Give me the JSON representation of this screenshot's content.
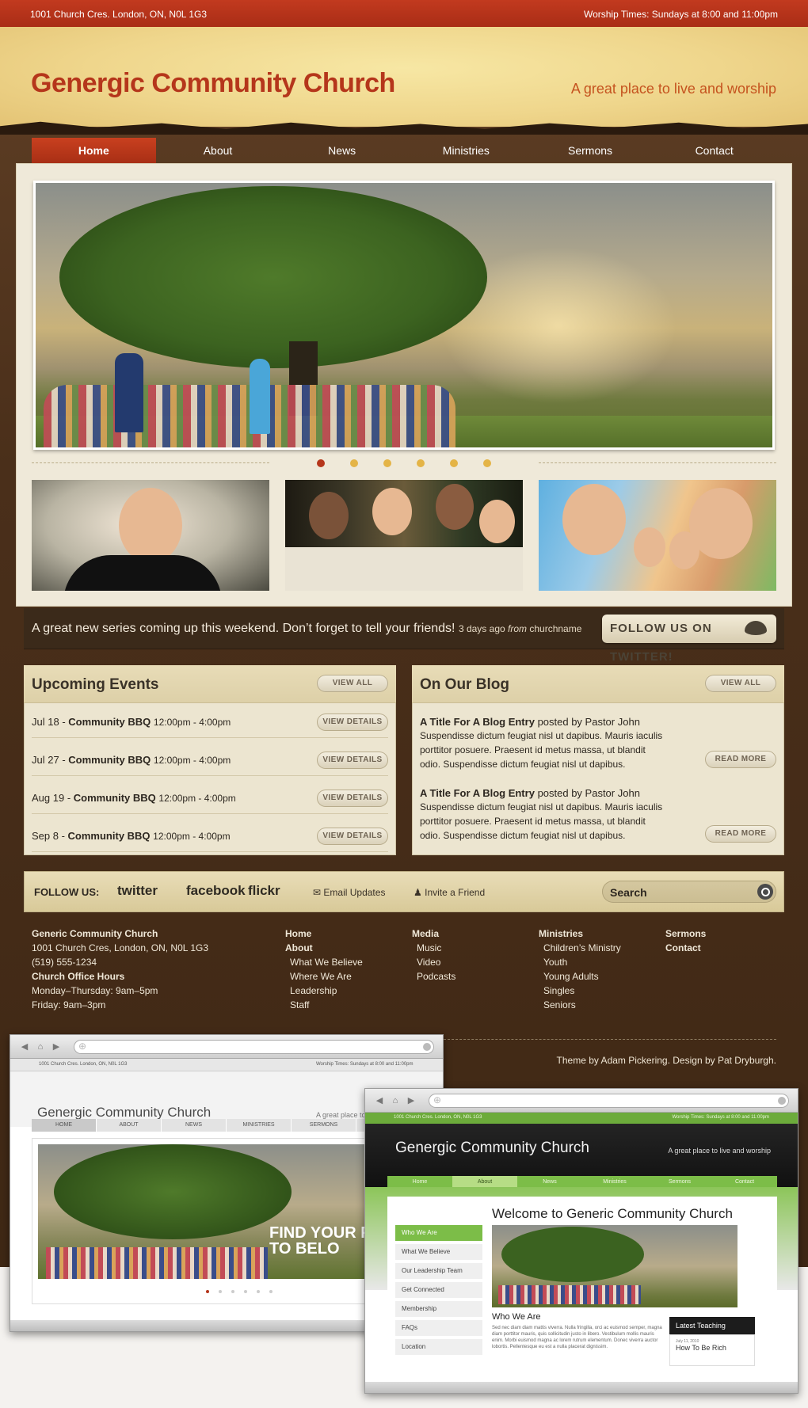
{
  "topbar": {
    "address": "1001 Church Cres. London, ON, N0L 1G3",
    "worship_times": "Worship Times: Sundays at 8:00 and 11:00pm"
  },
  "header": {
    "title": "Genergic Community Church",
    "tagline": "A great place to live and worship"
  },
  "nav": [
    "Home",
    "About",
    "News",
    "Ministries",
    "Sermons",
    "Contact"
  ],
  "slider": {
    "slide_count": 6,
    "active_slide": 1
  },
  "twitter": {
    "message": "A great new series coming up this weekend. Don’t forget to tell your friends!",
    "meta_time": "3 days ago",
    "meta_from": "from",
    "meta_source": "churchname",
    "follow_label": "FOLLOW US ON TWITTER!"
  },
  "events": {
    "title": "Upcoming Events",
    "view_all": "VIEW ALL",
    "details_label": "VIEW DETAILS",
    "items": [
      {
        "date": "Jul 18",
        "name": "Community BBQ",
        "time": "12:00pm - 4:00pm"
      },
      {
        "date": "Jul 27",
        "name": "Community BBQ",
        "time": "12:00pm - 4:00pm"
      },
      {
        "date": "Aug 19",
        "name": "Community BBQ",
        "time": "12:00pm - 4:00pm"
      },
      {
        "date": "Sep 8",
        "name": "Community BBQ",
        "time": "12:00pm - 4:00pm"
      }
    ]
  },
  "blog": {
    "title": "On Our Blog",
    "view_all": "VIEW ALL",
    "read_more": "READ MORE",
    "entries": [
      {
        "title": "A Title For A Blog Entry",
        "byline": "posted by Pastor John",
        "body": "Suspendisse dictum feugiat nisl ut dapibus. Mauris iaculis porttitor posuere. Praesent id metus massa, ut blandit odio. Suspendisse dictum feugiat nisl ut dapibus."
      },
      {
        "title": "A Title For A Blog Entry",
        "byline": "posted by Pastor John",
        "body": "Suspendisse dictum feugiat nisl ut dapibus. Mauris iaculis porttitor posuere. Praesent id metus massa, ut blandit odio. Suspendisse dictum feugiat nisl ut dapibus."
      }
    ]
  },
  "followbar": {
    "label": "FOLLOW US:",
    "twitter": "twitter",
    "facebook": "facebook",
    "flickr": "flickr",
    "email": "Email Updates",
    "invite": "Invite a Friend",
    "search": "Search"
  },
  "footer": {
    "org_name": "Generic Community Church",
    "org_address": "1001 Church Cres, London, ON, N0L 1G3",
    "org_phone": "(519) 555-1234",
    "hours_title": "Church Office Hours",
    "hours_1": "Monday–Thursday: 9am–5pm",
    "hours_2": "Friday: 9am–3pm",
    "col_home": "Home",
    "col_about": "About",
    "about_items": [
      "What We Believe",
      "Where We Are",
      "Leadership",
      "Staff"
    ],
    "col_media": "Media",
    "media_items": [
      "Music",
      "Video",
      "Podcasts"
    ],
    "col_ministries": "Ministries",
    "ministries_items": [
      "Children’s Ministry",
      "Youth",
      "Young Adults",
      "Singles",
      "Seniors"
    ],
    "col_sermons": "Sermons",
    "col_contact": "Contact",
    "credit": "Theme by Adam Pickering. Design by Pat Dryburgh."
  },
  "mockup1": {
    "bar_left": "1001 Church Cres. London, ON, N0L 1G3",
    "bar_right": "Worship Times: Sundays at 8:00 and 11:00pm",
    "title": "Genergic Community Church",
    "tag": "A great place to",
    "nav": [
      "HOME",
      "ABOUT",
      "NEWS",
      "MINISTRIES",
      "SERMONS"
    ],
    "hero_line1": "FIND YOUR PL",
    "hero_line2": "TO BELO"
  },
  "mockup2": {
    "bar_left": "1001 Church Cres. London, ON, N0L 1G3",
    "bar_right": "Worship Times: Sundays at 8:00 and 11:00pm",
    "title": "Genergic Community Church",
    "tag": "A great place to live and worship",
    "nav": [
      "Home",
      "About",
      "News",
      "Ministries",
      "Sermons",
      "Contact"
    ],
    "heading": "Welcome to Generic Community Church",
    "sidebar": [
      "Who We Are",
      "What We Believe",
      "Our Leadership Team",
      "Get Connected",
      "Membership",
      "FAQs",
      "Location"
    ],
    "subheading": "Who We Are",
    "lorem": "Sed nec diam diam mattis viverra. Nulla fringilla, orci ac euismod semper, magna diam porttitor mauris, quis sollicitudin justo in libero. Vestibulum mollis mauris enim. Morbi euismod magna ac lorem rutrum elementum. Donec viverra auctor lobortis. Pellentesque eu est a nulla placerat dignissim.",
    "latest_title": "Latest Teaching",
    "latest_date": "July 11, 2010",
    "latest_item": "How To Be Rich"
  },
  "colors": {
    "brand_red": "#b5361b",
    "accent_gold": "#e4b446",
    "dark_brown": "#3b2a1a",
    "mockup_green": "#7cbd48"
  }
}
